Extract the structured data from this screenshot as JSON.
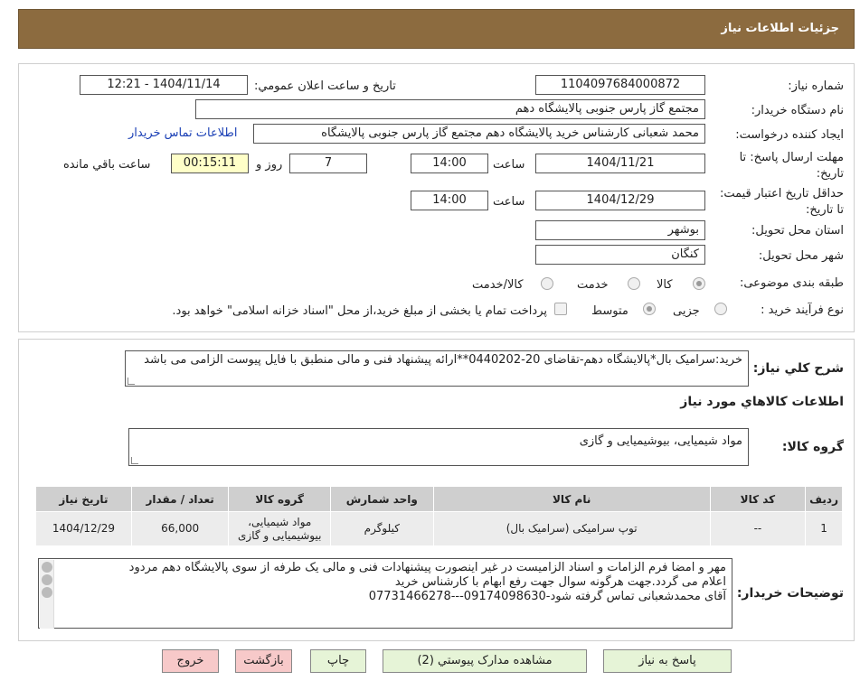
{
  "header": {
    "title": "جزئیات اطلاعات نیاز"
  },
  "fields": {
    "need_number_label": "شماره نیاز:",
    "need_number": "1104097684000872",
    "announce_label": "تاریخ و ساعت اعلان عمومي:",
    "announce_value": "1404/11/14 - 12:21",
    "buyer_org_label": "نام دستگاه خريدار:",
    "buyer_org": "مجتمع گاز پارس جنوبی  پالایشگاه دهم",
    "creator_label": "ايجاد کننده درخواست:",
    "creator": "محمد شعبانی کارشناس خرید پالایشگاه دهم  مجتمع گاز پارس جنوبی  پالایشگاه",
    "contact_link": "اطلاعات تماس خريدار",
    "send_deadline_label": "مهلت ارسال پاسخ: تا تاریخ:",
    "send_deadline_date": "1404/11/21",
    "time_label": "ساعت",
    "send_deadline_time": "14:00",
    "days_value": "7",
    "days_label": "روز و",
    "remaining_time": "00:15:11",
    "remaining_label": "ساعت باقي مانده",
    "validity_label": "حداقل تاریخ اعتبار قیمت: تا تاریخ:",
    "validity_date": "1404/12/29",
    "validity_time": "14:00",
    "province_label": "استان محل تحویل:",
    "province": "بوشهر",
    "city_label": "شهر محل تحویل:",
    "city": "کنگان",
    "category_label": "طبقه بندی موضوعی:",
    "category_options": [
      "کالا",
      "خدمت",
      "کالا/خدمت"
    ],
    "process_label": "نوع فرآیند خرید :",
    "process_options": [
      "جزیی",
      "متوسط"
    ],
    "payment_note": "پرداخت تمام یا بخشی از مبلغ خرید،از محل \"اسناد خزانه اسلامی\" خواهد بود."
  },
  "summary": {
    "label": "شرح کلي نياز:",
    "text": "خرید:سرامیک بال*پالایشگاه دهم-تقاضای 20-0440202**ارائه پیشنهاد فنی و مالی منطبق با فایل پیوست الزامی می باشد"
  },
  "goods": {
    "section_title": "اطلاعات کالاهاي مورد نياز",
    "group_label": "گروه کالا:",
    "group_value": "مواد شیمیایی، بیوشیمیایی و  گازی",
    "columns": [
      "رديف",
      "کد کالا",
      "نام کالا",
      "واحد شمارش",
      "گروه کالا",
      "تعداد / مقدار",
      "تاریخ نیاز"
    ],
    "rows": [
      [
        "1",
        "--",
        "توپ سرامیکی (سرامیک بال)",
        "کیلوگرم",
        "مواد شیمیایی، بیوشیمیایی و گازی",
        "66,000",
        "1404/12/29"
      ]
    ]
  },
  "buyer_notes": {
    "label": "توضیحات خریدار:",
    "lines": [
      "مهر و امضا فرم الزامات و اسناد الزامیست در غیر اینصورت پیشنهادات فنی و مالی یک طرفه از سوی پالایشگاه دهم مردود",
      "اعلام می گردد.جهت هرگونه سوال جهت رفع ابهام با کارشناس خرید",
      "آقای محمدشعبانی تماس گرفته شود-09174098630---07731466278"
    ]
  },
  "buttons": {
    "reply": "پاسخ به نیاز",
    "attachments": "مشاهده مدارک پیوستي (2)",
    "print": "چاپ",
    "back": "بازگشت",
    "exit": "خروج"
  },
  "colors": {
    "header": "#8c6b3f",
    "accent_link": "#1a3fb5",
    "yellow_field": "#ffffc8"
  }
}
